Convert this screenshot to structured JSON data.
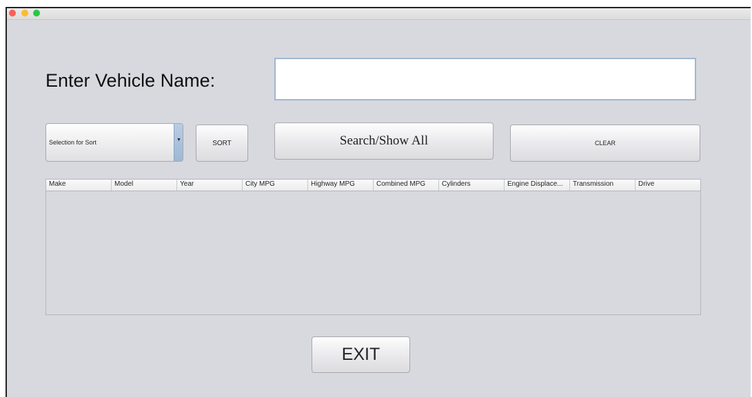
{
  "form": {
    "name_label": "Enter Vehicle Name:",
    "name_value": "",
    "sort_selection": "Selection for Sort",
    "sort_label": "SORT",
    "search_label": "Search/Show All",
    "clear_label": "CLEAR",
    "exit_label": "EXIT"
  },
  "table": {
    "columns": [
      "Make",
      "Model",
      "Year",
      "City MPG",
      "Highway MPG",
      "Combined MPG",
      "Cylinders",
      "Engine Displace...",
      "Transmission",
      "Drive"
    ],
    "rows": []
  },
  "colors": {
    "window_bg": "#d8d9de",
    "input_border": "#9fb6d0",
    "dropdown_arrow": "#9db7d6"
  }
}
